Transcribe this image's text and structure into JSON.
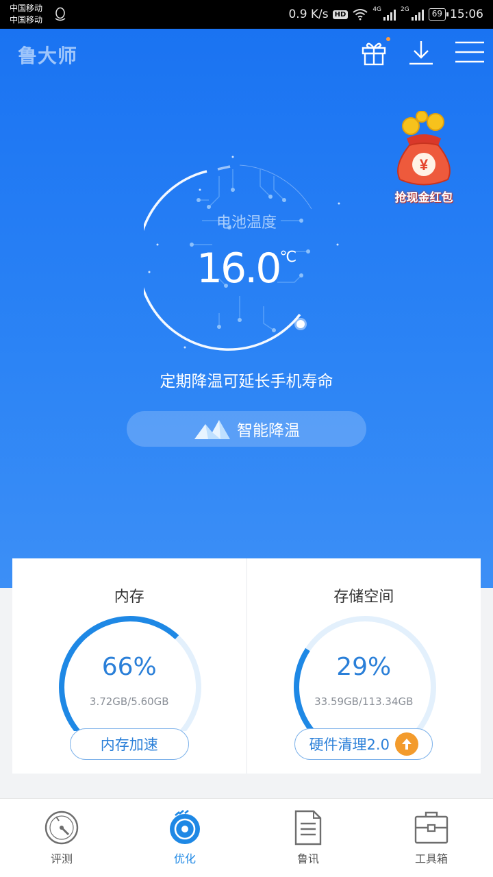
{
  "status_bar": {
    "carrier_1": "中国移动",
    "carrier_2": "中国移动",
    "net_speed": "0.9 K/s",
    "hd": "HD",
    "sig1_label": "4G",
    "sig2_label": "2G",
    "battery": "69",
    "time": "15:06"
  },
  "header": {
    "brand": "鲁大师",
    "icons": [
      "gift-icon",
      "download-icon",
      "menu-icon"
    ]
  },
  "promo": {
    "label": "抢现金红包",
    "symbol": "¥"
  },
  "thermometer": {
    "title": "电池温度",
    "value": "16.0",
    "unit": "℃"
  },
  "tip": "定期降温可延长手机寿命",
  "cool_button": "智能降温",
  "cards": {
    "memory": {
      "title": "内存",
      "percent": "66%",
      "fraction": 0.66,
      "usage": "3.72GB/5.60GB",
      "button": "内存加速"
    },
    "storage": {
      "title": "存储空间",
      "percent": "29%",
      "fraction": 0.29,
      "usage": "33.59GB/113.34GB",
      "button": "硬件清理2.0"
    }
  },
  "nav": {
    "items": [
      {
        "label": "评测",
        "icon": "speedometer-icon"
      },
      {
        "label": "优化",
        "icon": "optimize-disc-icon",
        "active": true
      },
      {
        "label": "鲁讯",
        "icon": "document-icon"
      },
      {
        "label": "工具箱",
        "icon": "toolbox-icon"
      }
    ]
  },
  "colors": {
    "brand_blue": "#1a73f2",
    "accent_blue": "#2a7fd8",
    "badge_orange": "#f39b2c"
  }
}
